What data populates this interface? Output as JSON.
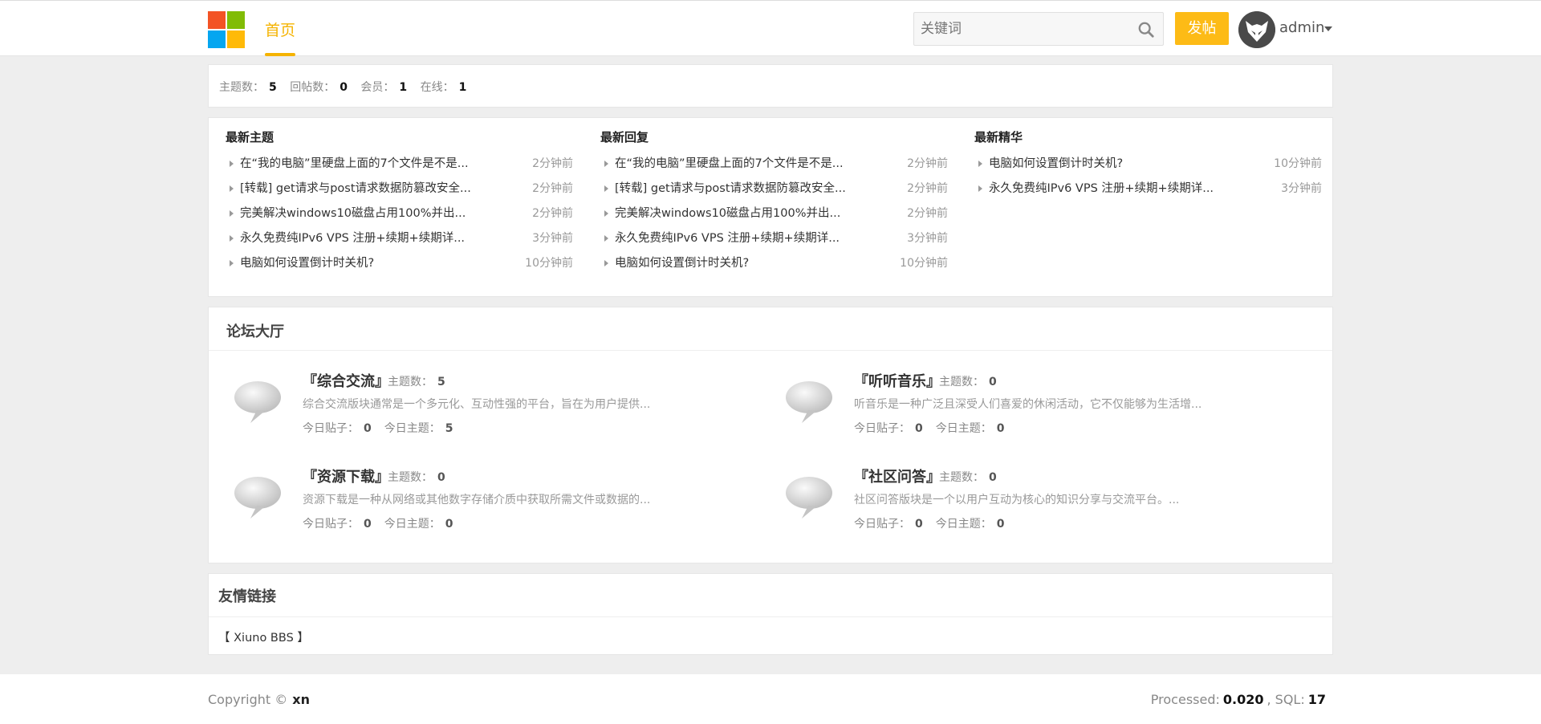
{
  "header": {
    "logo_colors": [
      "#f35325",
      "#81bc06",
      "#05a6f0",
      "#ffba08"
    ],
    "nav_home": "首页",
    "search_placeholder": "关键词",
    "post_button": "发帖",
    "username": "admin"
  },
  "stats": {
    "topics_label": "主题数：",
    "topics": "5",
    "replies_label": "回帖数：",
    "replies": "0",
    "members_label": "会员：",
    "members": "1",
    "online_label": "在线：",
    "online": "1"
  },
  "latest": {
    "columns": [
      {
        "title": "最新主题",
        "items": [
          {
            "title": "在“我的电脑”里硬盘上面的7个文件是不是...",
            "time": "2分钟前"
          },
          {
            "title": "[转载] get请求与post请求数据防篡改安全...",
            "time": "2分钟前"
          },
          {
            "title": "完美解决windows10磁盘占用100%并出...",
            "time": "2分钟前"
          },
          {
            "title": "永久免费纯IPv6 VPS 注册+续期+续期详...",
            "time": "3分钟前"
          },
          {
            "title": "电脑如何设置倒计时关机?",
            "time": "10分钟前"
          }
        ]
      },
      {
        "title": "最新回复",
        "items": [
          {
            "title": "在“我的电脑”里硬盘上面的7个文件是不是...",
            "time": "2分钟前"
          },
          {
            "title": "[转载] get请求与post请求数据防篡改安全...",
            "time": "2分钟前"
          },
          {
            "title": "完美解决windows10磁盘占用100%并出...",
            "time": "2分钟前"
          },
          {
            "title": "永久免费纯IPv6 VPS 注册+续期+续期详...",
            "time": "3分钟前"
          },
          {
            "title": "电脑如何设置倒计时关机?",
            "time": "10分钟前"
          }
        ]
      },
      {
        "title": "最新精华",
        "items": [
          {
            "title": "电脑如何设置倒计时关机?",
            "time": "10分钟前"
          },
          {
            "title": "永久免费纯IPv6 VPS 注册+续期+续期详...",
            "time": "3分钟前"
          }
        ]
      }
    ]
  },
  "forum": {
    "title": "论坛大厅",
    "topic_label": "主题数：",
    "today_posts_label": "今日贴子：",
    "today_topics_label": "今日主题：",
    "boards": [
      {
        "name": "『综合交流』",
        "topics": "5",
        "desc": "综合交流版块通常是一个多元化、互动性强的平台，旨在为用户提供...",
        "today_posts": "0",
        "today_topics": "5"
      },
      {
        "name": "『听听音乐』",
        "topics": "0",
        "desc": "听音乐是一种广泛且深受人们喜爱的休闲活动，它不仅能够为生活增...",
        "today_posts": "0",
        "today_topics": "0"
      },
      {
        "name": "『资源下载』",
        "topics": "0",
        "desc": "资源下载是一种从网络或其他数字存储介质中获取所需文件或数据的...",
        "today_posts": "0",
        "today_topics": "0"
      },
      {
        "name": "『社区问答』",
        "topics": "0",
        "desc": "社区问答版块是一个以用户互动为核心的知识分享与交流平台。...",
        "today_posts": "0",
        "today_topics": "0"
      }
    ]
  },
  "links": {
    "title": "友情链接",
    "items": [
      "【 Xiuno BBS 】"
    ]
  },
  "footer": {
    "copyright_label": "Copyright ©",
    "copyright_name": "xn",
    "processed_label": "Processed:",
    "processed": "0.020",
    "sql_label": ", SQL:",
    "sql": "17"
  }
}
